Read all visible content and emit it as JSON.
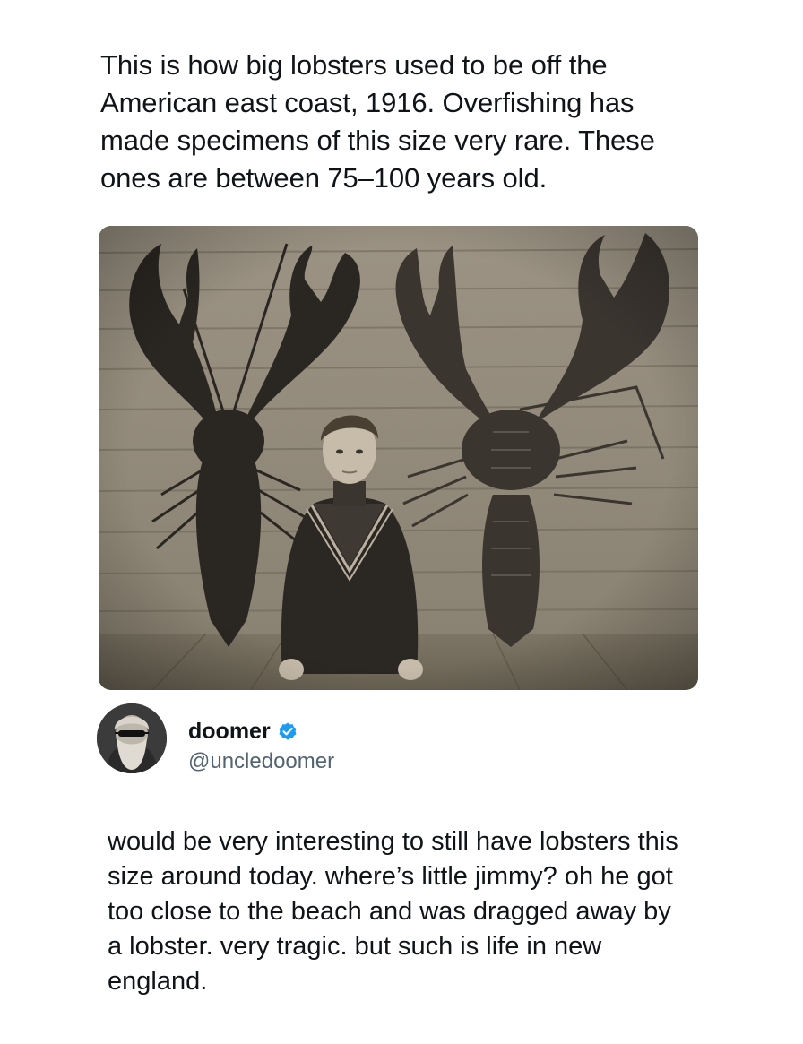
{
  "post": {
    "caption": "This is how big lobsters used to be off the American east coast, 1916. Overfishing has made specimens of this size very rare. These ones are between 75–100 years old.",
    "photo_icon": "historical-photo-boy-with-giant-lobsters"
  },
  "reply": {
    "display_name": "doomer",
    "handle": "@uncledoomer",
    "verified_icon": "verified-badge-icon",
    "verified_color": "#1d9bf0",
    "text": "would be very interesting to still have lobsters this size around today. where’s little jimmy? oh he got too close to the beach and was dragged away by a lobster. very tragic. but such is life in new england."
  },
  "colors": {
    "text_primary": "#0f1419",
    "text_secondary": "#536471",
    "background": "#ffffff"
  }
}
